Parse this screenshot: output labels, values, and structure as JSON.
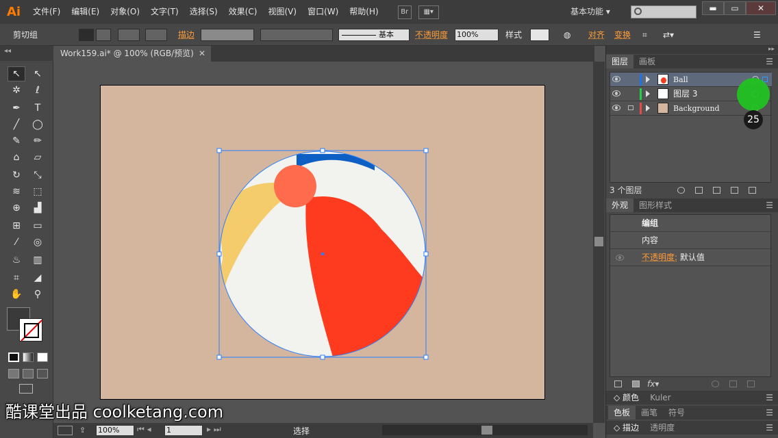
{
  "menubar": {
    "logo": "Ai",
    "items": [
      "文件(F)",
      "编辑(E)",
      "对象(O)",
      "文字(T)",
      "选择(S)",
      "效果(C)",
      "视图(V)",
      "窗口(W)",
      "帮助(H)"
    ],
    "bridge_label": "Br",
    "workspace": "基本功能",
    "minimize": "▬",
    "maximize": "▭",
    "close": "✕"
  },
  "control": {
    "selection_type": "剪切组",
    "stroke_label": "描边",
    "stroke_profile": "基本",
    "opacity_label": "不透明度",
    "opacity_value": "100%",
    "style_label": "样式",
    "align_label": "对齐",
    "transform_label": "变换"
  },
  "document": {
    "tab_title": "Work159.ai* @ 100% (RGB/预览)",
    "close": "✕"
  },
  "status": {
    "zoom": "100%",
    "artboard_number": "1",
    "tool_name": "选择"
  },
  "layers_panel": {
    "tabs": [
      "图层",
      "画板"
    ],
    "layers": [
      {
        "name": "Ball",
        "color": "#1e73e8",
        "selected": true,
        "locked": false
      },
      {
        "name": "图层 3",
        "color": "#22d04a",
        "selected": false,
        "locked": false
      },
      {
        "name": "Background",
        "color": "#e84a4a",
        "selected": false,
        "locked": true
      }
    ],
    "count_label": "3 个图层"
  },
  "appearance_panel": {
    "tabs": [
      "外观",
      "图形样式"
    ],
    "group_label": "编组",
    "contents_label": "内容",
    "opacity_label": "不透明度:",
    "opacity_value": "默认值"
  },
  "docked_tabs": {
    "color": [
      "颜色",
      "Kuler"
    ],
    "swatches": [
      "色板",
      "画笔",
      "符号"
    ],
    "pathfinder": [
      "描边",
      "透明度"
    ]
  },
  "overlay": {
    "click_number": "25",
    "watermark": "酷课堂出品 coolketang.com"
  },
  "colors": {
    "artboard": "#d4b59d",
    "ball_white": "#f2f2ef",
    "ball_red": "#ff3b1f",
    "ball_blue": "#0d5fc4",
    "ball_yellow": "#f5cc6c",
    "ball_cap": "#ff6b4d",
    "selection": "#2a7fff"
  }
}
